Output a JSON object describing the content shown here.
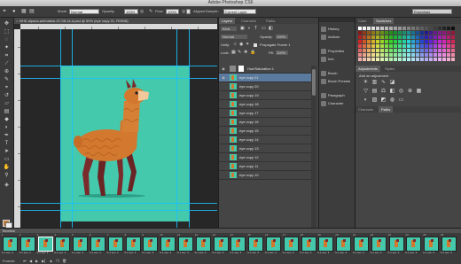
{
  "window": {
    "title": "Adobe Photoshop CS6",
    "workspace": "Essentials"
  },
  "options_bar": {
    "mode_label": "Mode:",
    "mode_value": "Normal",
    "opacity_label": "Opacity:",
    "opacity_value": "100%",
    "flow_label": "Flow:",
    "flow_value": "100%",
    "aligned_label": "Aligned",
    "sample_label": "Sample:",
    "sample_value": "Current Layer"
  },
  "document": {
    "tab": "NHK-alpaca-animation-07-08-14-d.psd @ 50% (eye copy 21, RGB/8)"
  },
  "layers_panel": {
    "tabs": [
      "Layers",
      "Channels",
      "Paths"
    ],
    "kind": "Kind",
    "blend": "Normal",
    "opacity_label": "Opacity:",
    "opacity_value": "100%",
    "unify_label": "Unify:",
    "propagate_label": "Propagate Frame 1",
    "lock_label": "Lock:",
    "fill_label": "Fill:",
    "fill_value": "100%",
    "layers": [
      "Hue/Saturation 1",
      "eye copy 21",
      "eye copy 20",
      "eye copy 19",
      "eye copy 18",
      "eye copy 17",
      "eye copy 16",
      "eye copy 15",
      "eye copy 14",
      "eye copy 13",
      "eye copy 12",
      "eye copy 11",
      "eye copy 10"
    ]
  },
  "icon_panels": {
    "group1": [
      "History",
      "Actions"
    ],
    "group2": [
      "Properties",
      "Info"
    ],
    "group3": [
      "Brush",
      "Brush Presets"
    ],
    "group4": [
      "Paragraph",
      "Character"
    ]
  },
  "right_panels": {
    "swatch_tabs": [
      "Color",
      "Swatches"
    ],
    "adjust_tabs": [
      "Adjustments",
      "Styles"
    ],
    "adjust_title": "Add an adjustment",
    "channel_tabs": [
      "Channels",
      "Paths"
    ]
  },
  "timeline": {
    "title": "Timeline",
    "frame_count": 26,
    "selected_frame": 3,
    "duration": "0.1 sec.",
    "loop": "Forever"
  },
  "colors": {
    "canvas_bg": "#44c9ac",
    "guide": "#19c1ff",
    "alpaca_body": "#d2782f",
    "alpaca_leg": "#7a2c2c",
    "selected_layer": "#5a7a9e"
  }
}
